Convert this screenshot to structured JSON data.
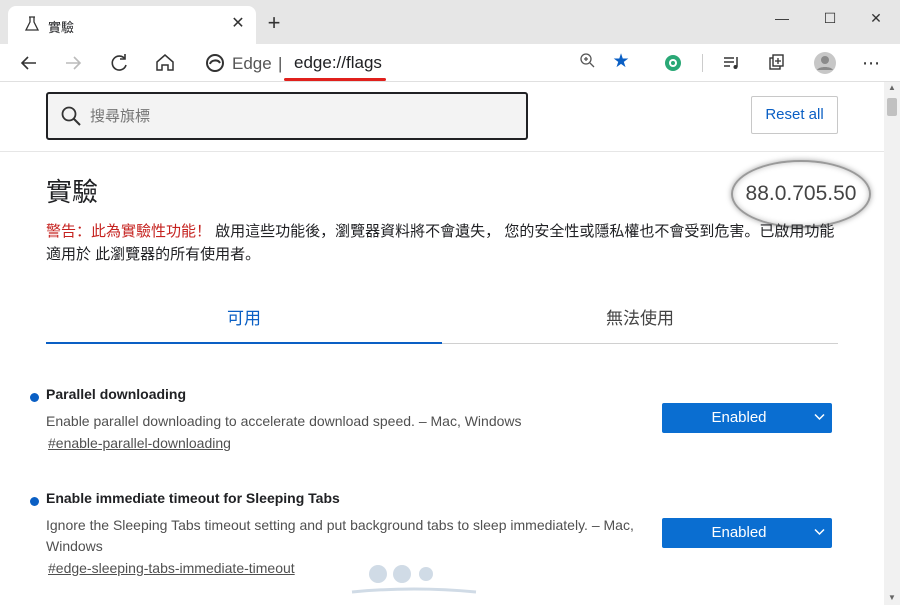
{
  "tab": {
    "title": "實驗"
  },
  "omnibox": {
    "brand": "Edge",
    "separator": "|",
    "url": "edge://flags"
  },
  "search": {
    "placeholder": "搜尋旗標"
  },
  "reset_label": "Reset all",
  "page_title": "實驗",
  "version": "88.0.705.50",
  "warning": {
    "red": "警告：此為實驗性功能！",
    "text": " 啟用這些功能後，瀏覽器資料將不會遺失， 您的安全性或隱私權也不會受到危害。已啟用功能適用於 此瀏覽器的所有使用者。"
  },
  "tabs": [
    {
      "label": "可用",
      "active": true
    },
    {
      "label": "無法使用",
      "active": false
    }
  ],
  "flags": [
    {
      "name": "Parallel downloading",
      "desc": "Enable parallel downloading to accelerate download speed. – Mac, Windows",
      "link": "#enable-parallel-downloading",
      "value": "Enabled"
    },
    {
      "name": "Enable immediate timeout for Sleeping Tabs",
      "desc": "Ignore the Sleeping Tabs timeout setting and put background tabs to sleep immediately. – Mac, Windows",
      "link": "#edge-sleeping-tabs-immediate-timeout",
      "value": "Enabled"
    }
  ],
  "colors": {
    "accent": "#0a5fc4",
    "warning": "#c5221f",
    "select_bg": "#0a6ed1",
    "underline": "#e0201c"
  },
  "icons": {
    "tab": "flask-icon",
    "back": "back-arrow-icon",
    "forward": "forward-arrow-icon",
    "refresh": "refresh-icon",
    "home": "home-icon",
    "zoom": "zoom-icon",
    "favorite": "star-icon",
    "extension": "extension-icon",
    "media": "media-control-icon",
    "collections": "collections-icon",
    "profile": "profile-icon",
    "menu": "more-icon"
  }
}
